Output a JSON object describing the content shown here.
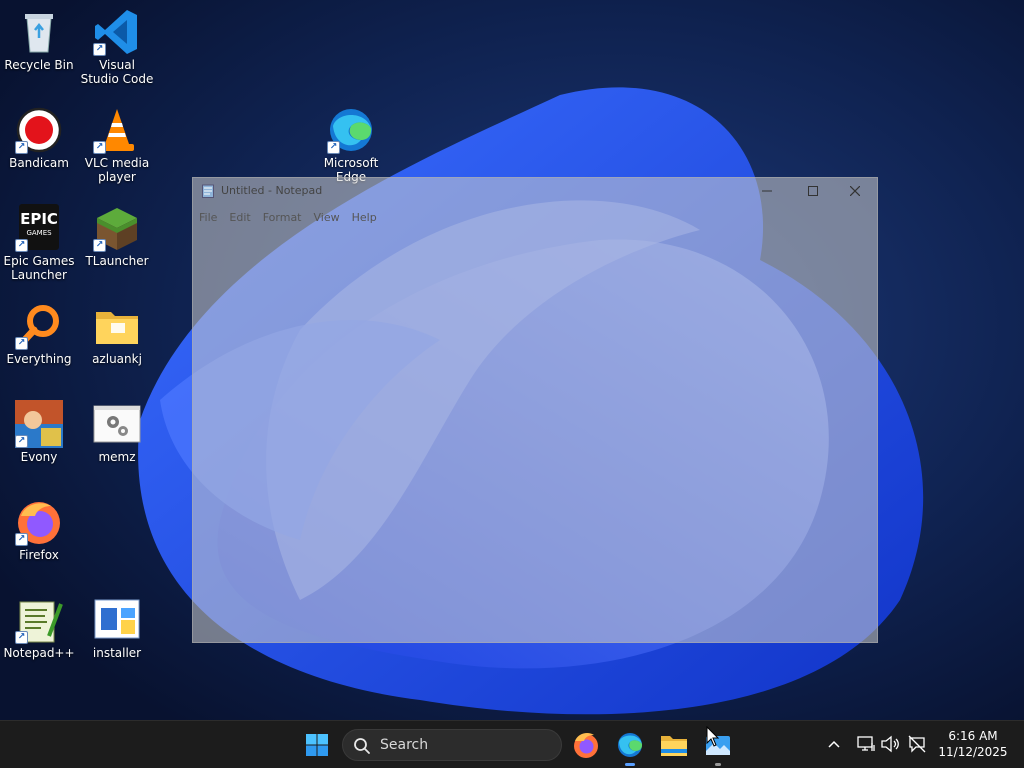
{
  "desktop": {
    "icons": [
      {
        "id": "recycle-bin",
        "label": "Recycle Bin"
      },
      {
        "id": "vscode",
        "label": "Visual Studio Code"
      },
      {
        "id": "bandicam",
        "label": "Bandicam"
      },
      {
        "id": "vlc",
        "label": "VLC media player"
      },
      {
        "id": "edge",
        "label": "Microsoft Edge"
      },
      {
        "id": "epic",
        "label": "Epic Games Launcher"
      },
      {
        "id": "tlauncher",
        "label": "TLauncher"
      },
      {
        "id": "everything",
        "label": "Everything"
      },
      {
        "id": "azluankj",
        "label": "azluankj"
      },
      {
        "id": "evony",
        "label": "Evony"
      },
      {
        "id": "memz",
        "label": "memz"
      },
      {
        "id": "firefox",
        "label": "Firefox"
      },
      {
        "id": "notepadpp",
        "label": "Notepad++"
      },
      {
        "id": "installer",
        "label": "installer"
      }
    ],
    "epic_logo_text": "EPIC",
    "epic_logo_sub": "GAMES"
  },
  "notepad": {
    "title": "Untitled - Notepad",
    "menu": [
      "File",
      "Edit",
      "Format",
      "View",
      "Help"
    ],
    "content": ""
  },
  "taskbar": {
    "search_label": "Search",
    "pinned": [
      "start-button",
      "search",
      "firefox",
      "edge",
      "file-explorer",
      "photos"
    ],
    "clock": {
      "time": "6:16 AM",
      "date": "11/12/2025"
    }
  },
  "colors": {
    "taskbar_bg": "#1c1c1c",
    "accent": "#5aa0ff",
    "wallpaper_dark": "#0a1633",
    "wallpaper_bloom": "#2a5cff"
  }
}
